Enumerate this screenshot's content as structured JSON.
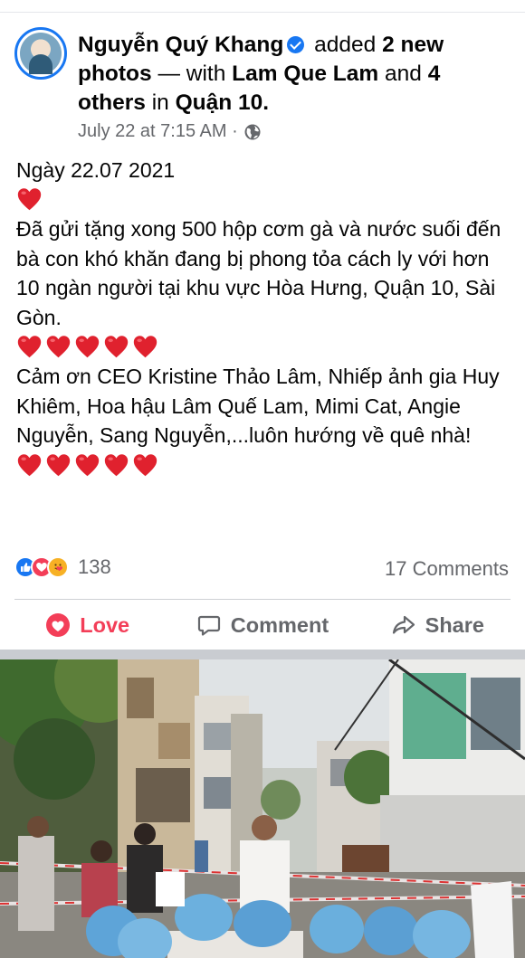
{
  "post": {
    "author": "Nguyễn Quý Khang",
    "action_text": "added",
    "photos_text": "2 new photos",
    "with_text": "— with",
    "tagged_person": "Lam Que Lam",
    "and_text": "and",
    "others_text": "4 others",
    "in_text": "in",
    "location": "Quận 10.",
    "timestamp": "July 22 at 7:15 AM ·",
    "privacy_icon": "globe-icon",
    "date_line": "Ngày 22.07 2021",
    "paragraph_1": "Đã gửi tặng xong 500 hộp cơm gà và nước suối đến bà con khó khăn đang bị phong tỏa cách ly với hơn 10 ngàn người tại khu vực Hòa Hưng, Quận 10, Sài Gòn.",
    "paragraph_2": "Cảm ơn CEO Kristine Thảo Lâm, Nhiếp ảnh gia Huy Khiêm, Hoa hậu Lâm Quế Lam, Mimi Cat, Angie Nguyễn, Sang Nguyễn,...luôn hướng về quê nhà!"
  },
  "stats": {
    "reaction_count": "138",
    "comments": "17 Comments"
  },
  "actions": {
    "love": "Love",
    "comment": "Comment",
    "share": "Share"
  },
  "colors": {
    "brand_blue": "#1877f2",
    "love_red": "#f33e58",
    "secondary_text": "#65676b"
  }
}
